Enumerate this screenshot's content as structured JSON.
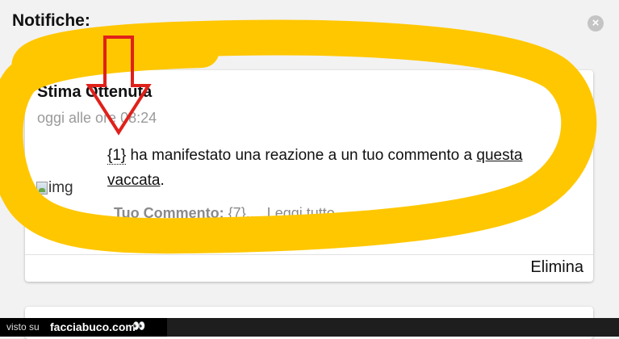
{
  "header": {
    "title": "Notifiche:",
    "close_icon": "close-icon"
  },
  "notification": {
    "title": "Stima Ottenuta",
    "time": "oggi alle ore 08:24",
    "image_alt": "img",
    "message": {
      "user_placeholder": "{1}",
      "text": " ha manifestato una reazione a un tuo commento a ",
      "link_text": "questa vaccata",
      "end": "."
    },
    "comment_label": "Tuo Commento:",
    "comment_value": "{7}...",
    "read_more": "Leggi tutto",
    "delete_label": "Elimina"
  },
  "watermark": {
    "visto": "visto su",
    "brand": "facciabuco.com",
    "eyes": "👀"
  },
  "colors": {
    "highlight": "#FFC700",
    "arrow": "#E0201A"
  }
}
